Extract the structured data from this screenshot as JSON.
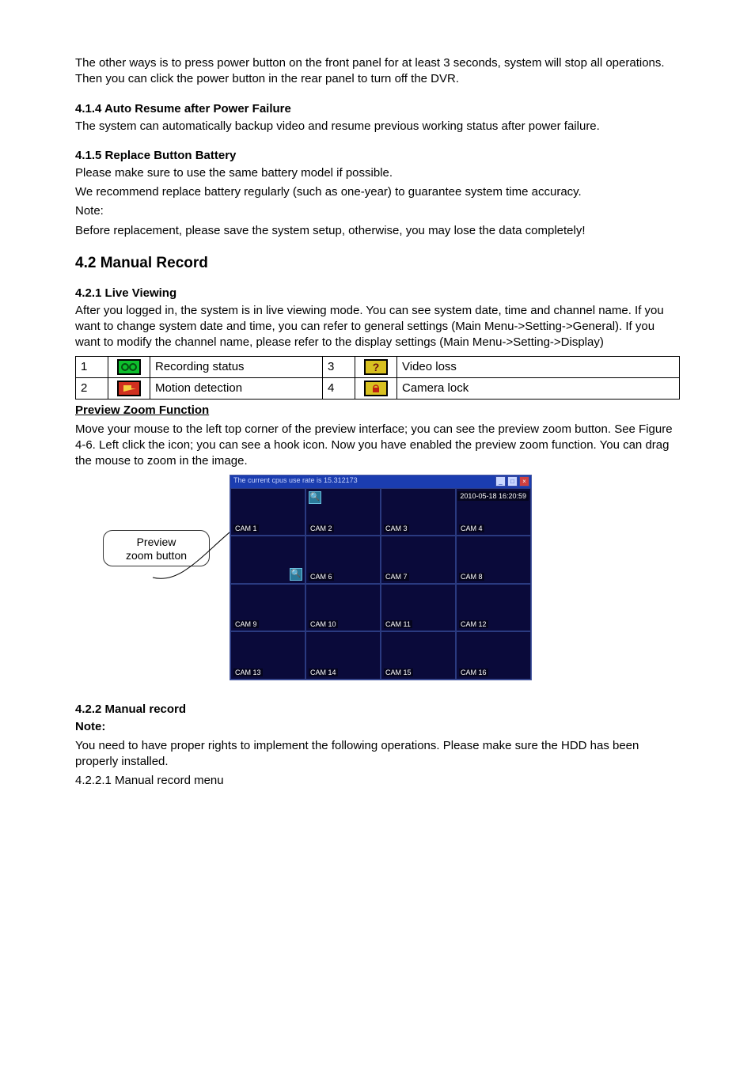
{
  "intro": {
    "p1": "The other ways is to press power button on the front panel for at least 3 seconds, system will stop all operations. Then you can click the power button in the rear panel to turn off the DVR."
  },
  "s414": {
    "title": "4.1.4   Auto Resume after Power Failure",
    "p1": "The system can automatically backup video and resume previous working status after power failure."
  },
  "s415": {
    "title": "4.1.5  Replace Button Battery",
    "p1": "Please make sure to use the same battery model if possible.",
    "p2": "We recommend replace battery regularly (such as one-year) to guarantee system time accuracy.",
    "p3": "Note:",
    "p4": "Before replacement, please save the system setup, otherwise, you may lose the data completely!"
  },
  "s42": {
    "title": "4.2   Manual Record"
  },
  "s421": {
    "title": "4.2.1   Live Viewing",
    "p1": "After you logged in, the system is in live viewing mode. You can see system date, time and channel name. If you want to change system date and time, you can refer to general settings (Main Menu->Setting->General). If you want to modify the channel name, please refer to the display settings (Main Menu->Setting->Display)"
  },
  "legend": {
    "r1": {
      "n1": "1",
      "label1": "Recording status",
      "n2": "3",
      "label2": "Video loss"
    },
    "r2": {
      "n1": "2",
      "label1": "Motion detection",
      "n2": "4",
      "label2": "Camera lock"
    }
  },
  "zoom": {
    "title": "Preview Zoom Function",
    "p1": "Move your mouse to the left top corner of the preview interface; you can see the preview zoom button. See Figure 4-6. Left click the icon; you can see a hook icon. Now you have enabled the preview zoom function. You can drag the mouse to zoom in the image.",
    "callout_l1": "Preview",
    "callout_l2": "zoom button"
  },
  "shot": {
    "titlebar": "The current cpus use rate is  15.312173",
    "timestamp": "2010-05-18 16:20:59",
    "cams": [
      "CAM 1",
      "CAM 2",
      "CAM 3",
      "CAM 4",
      "",
      "CAM 6",
      "CAM 7",
      "CAM 8",
      "CAM 9",
      "CAM 10",
      "CAM 11",
      "CAM 12",
      "CAM 13",
      "CAM 14",
      "CAM 15",
      "CAM 16"
    ]
  },
  "s422": {
    "title": "4.2.2   Manual record",
    "note": "Note:",
    "p1": "You need to have proper rights to implement the following operations. Please make sure the HDD has been properly installed.",
    "sub": "4.2.2.1  Manual record menu"
  }
}
